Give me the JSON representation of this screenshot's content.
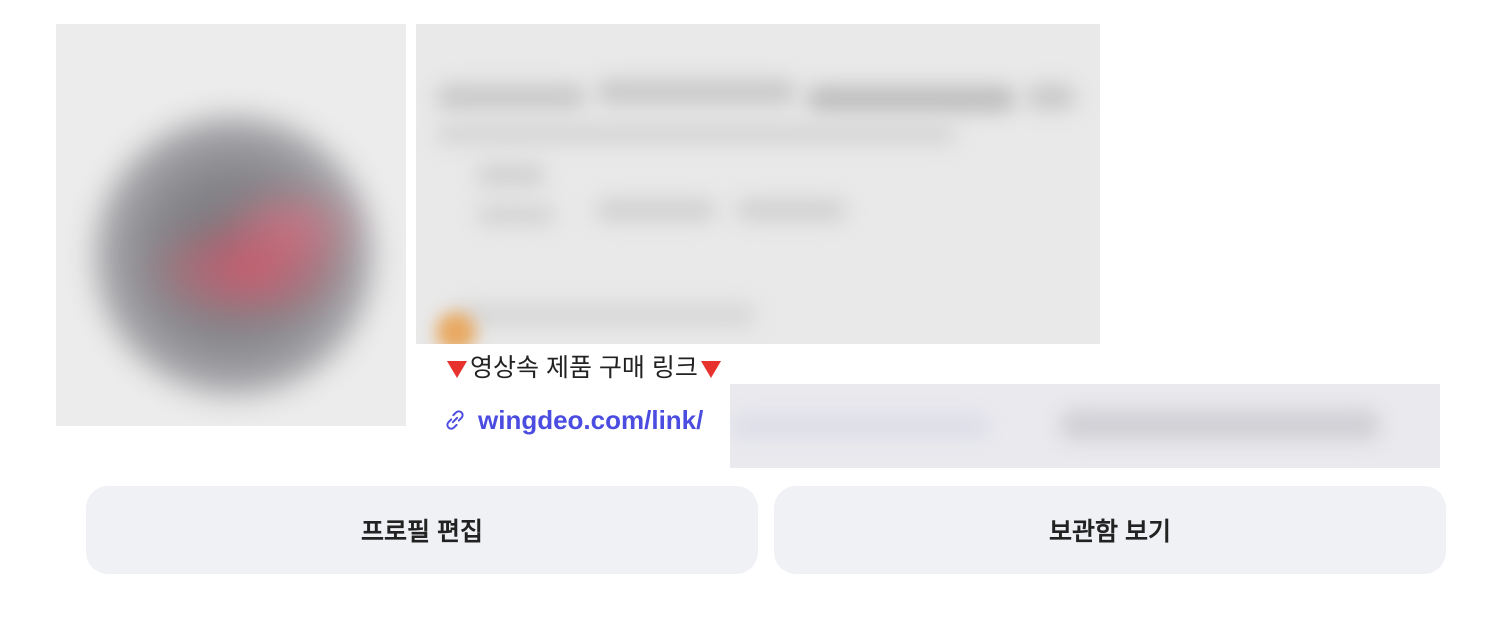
{
  "profile": {
    "bio_caption_text": "영상속 제품 구매 링크",
    "link_text": "wingdeo.com/link/",
    "link_color": "#4b4ce0",
    "triangle_color": "#e8322e",
    "caption_icons": [
      "red-triangle-down-icon",
      "red-triangle-down-icon"
    ],
    "link_icon": "link-icon"
  },
  "actions": {
    "edit_profile_label": "프로필 편집",
    "view_archive_label": "보관함 보기",
    "button_background": "#f0f1f5"
  }
}
